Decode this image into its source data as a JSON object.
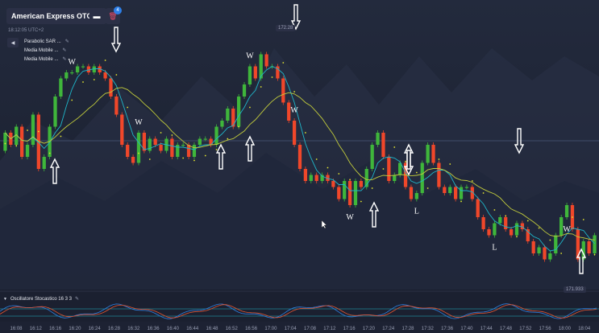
{
  "header": {
    "asset_label": "American Express OTC",
    "menu_icon": "dash-icon",
    "delete_icon": "trash-icon",
    "badge_count": "4",
    "clock": "18:12:05 UTC+2"
  },
  "indicators": [
    {
      "label": "Parabolic SAR ..."
    },
    {
      "label": "Media Mobile ..."
    },
    {
      "label": "Media Mobile ..."
    }
  ],
  "oscillator": {
    "label": "Oscillatore Stocastico  16 3 3"
  },
  "price_tags": {
    "high": "172.28",
    "low": "171.933"
  },
  "colors": {
    "bull": "#3fb63b",
    "bear": "#f0472a",
    "ma_fast": "#1fb6c9",
    "ma_slow": "#c2cc3c",
    "sar": "#e3e52f",
    "stoch_k": "#2e7fe0",
    "stoch_d": "#e5542f",
    "osc_band": "#1fb6c9"
  },
  "chart_data": {
    "type": "candlestick",
    "x_ticks": [
      "16:08",
      "16:12",
      "16:16",
      "16:20",
      "16:24",
      "16:28",
      "16:32",
      "16:36",
      "16:40",
      "16:44",
      "16:48",
      "16:52",
      "16:56",
      "17:00",
      "17:04",
      "17:08",
      "17:12",
      "17:16",
      "17:20",
      "17:24",
      "17:28",
      "17:32",
      "17:36",
      "17:40",
      "17:44",
      "17:48",
      "17:52",
      "17:56",
      "18:00",
      "18:04"
    ],
    "ylim": [
      171.9,
      172.3
    ],
    "candles": [
      {
        "o": 172.11,
        "c": 172.14
      },
      {
        "o": 172.14,
        "c": 172.12
      },
      {
        "o": 172.12,
        "c": 172.15
      },
      {
        "o": 172.15,
        "c": 172.1
      },
      {
        "o": 172.1,
        "c": 172.12
      },
      {
        "o": 172.12,
        "c": 172.17
      },
      {
        "o": 172.17,
        "c": 172.08
      },
      {
        "o": 172.08,
        "c": 172.1
      },
      {
        "o": 172.1,
        "c": 172.15
      },
      {
        "o": 172.15,
        "c": 172.2
      },
      {
        "o": 172.2,
        "c": 172.23
      },
      {
        "o": 172.23,
        "c": 172.24
      },
      {
        "o": 172.24,
        "c": 172.24
      },
      {
        "o": 172.24,
        "c": 172.25
      },
      {
        "o": 172.25,
        "c": 172.25
      },
      {
        "o": 172.25,
        "c": 172.24
      },
      {
        "o": 172.24,
        "c": 172.25
      },
      {
        "o": 172.25,
        "c": 172.24
      },
      {
        "o": 172.24,
        "c": 172.23
      },
      {
        "o": 172.23,
        "c": 172.2
      },
      {
        "o": 172.2,
        "c": 172.17
      },
      {
        "o": 172.17,
        "c": 172.12
      },
      {
        "o": 172.12,
        "c": 172.1
      },
      {
        "o": 172.1,
        "c": 172.09
      },
      {
        "o": 172.09,
        "c": 172.14
      },
      {
        "o": 172.14,
        "c": 172.11
      },
      {
        "o": 172.11,
        "c": 172.13
      },
      {
        "o": 172.13,
        "c": 172.12
      },
      {
        "o": 172.12,
        "c": 172.11
      },
      {
        "o": 172.11,
        "c": 172.13
      },
      {
        "o": 172.13,
        "c": 172.1
      },
      {
        "o": 172.1,
        "c": 172.12
      },
      {
        "o": 172.12,
        "c": 172.12
      },
      {
        "o": 172.12,
        "c": 172.1
      },
      {
        "o": 172.1,
        "c": 172.12
      },
      {
        "o": 172.12,
        "c": 172.13
      },
      {
        "o": 172.13,
        "c": 172.13
      },
      {
        "o": 172.13,
        "c": 172.12
      },
      {
        "o": 172.12,
        "c": 172.15
      },
      {
        "o": 172.15,
        "c": 172.16
      },
      {
        "o": 172.16,
        "c": 172.18
      },
      {
        "o": 172.18,
        "c": 172.15
      },
      {
        "o": 172.15,
        "c": 172.2
      },
      {
        "o": 172.2,
        "c": 172.22
      },
      {
        "o": 172.22,
        "c": 172.25
      },
      {
        "o": 172.25,
        "c": 172.23
      },
      {
        "o": 172.23,
        "c": 172.27
      },
      {
        "o": 172.27,
        "c": 172.25
      },
      {
        "o": 172.25,
        "c": 172.25
      },
      {
        "o": 172.25,
        "c": 172.23
      },
      {
        "o": 172.23,
        "c": 172.19
      },
      {
        "o": 172.19,
        "c": 172.16
      },
      {
        "o": 172.16,
        "c": 172.12
      },
      {
        "o": 172.12,
        "c": 172.08
      },
      {
        "o": 172.08,
        "c": 172.06
      },
      {
        "o": 172.06,
        "c": 172.07
      },
      {
        "o": 172.07,
        "c": 172.06
      },
      {
        "o": 172.06,
        "c": 172.07
      },
      {
        "o": 172.07,
        "c": 172.06
      },
      {
        "o": 172.06,
        "c": 172.05
      },
      {
        "o": 172.05,
        "c": 172.03
      },
      {
        "o": 172.03,
        "c": 172.06
      },
      {
        "o": 172.06,
        "c": 172.02
      },
      {
        "o": 172.02,
        "c": 172.06
      },
      {
        "o": 172.06,
        "c": 172.05
      },
      {
        "o": 172.05,
        "c": 172.08
      },
      {
        "o": 172.08,
        "c": 172.12
      },
      {
        "o": 172.12,
        "c": 172.14
      },
      {
        "o": 172.14,
        "c": 172.1
      },
      {
        "o": 172.1,
        "c": 172.06
      },
      {
        "o": 172.06,
        "c": 172.07
      },
      {
        "o": 172.07,
        "c": 172.09
      },
      {
        "o": 172.09,
        "c": 172.05
      },
      {
        "o": 172.05,
        "c": 172.03
      },
      {
        "o": 172.03,
        "c": 172.04
      },
      {
        "o": 172.04,
        "c": 172.09
      },
      {
        "o": 172.09,
        "c": 172.12
      },
      {
        "o": 172.12,
        "c": 172.09
      },
      {
        "o": 172.09,
        "c": 172.05
      },
      {
        "o": 172.05,
        "c": 172.04
      },
      {
        "o": 172.04,
        "c": 172.05
      },
      {
        "o": 172.05,
        "c": 172.03
      },
      {
        "o": 172.03,
        "c": 172.05
      },
      {
        "o": 172.05,
        "c": 172.05
      },
      {
        "o": 172.05,
        "c": 172.03
      },
      {
        "o": 172.03,
        "c": 172.0
      },
      {
        "o": 172.0,
        "c": 171.98
      },
      {
        "o": 171.98,
        "c": 171.97
      },
      {
        "o": 171.97,
        "c": 171.99
      },
      {
        "o": 171.99,
        "c": 172.0
      },
      {
        "o": 172.0,
        "c": 171.98
      },
      {
        "o": 171.98,
        "c": 171.97
      },
      {
        "o": 171.97,
        "c": 171.99
      },
      {
        "o": 171.99,
        "c": 171.98
      },
      {
        "o": 171.98,
        "c": 171.96
      },
      {
        "o": 171.96,
        "c": 171.94
      },
      {
        "o": 171.94,
        "c": 171.95
      },
      {
        "o": 171.95,
        "c": 171.93
      },
      {
        "o": 171.93,
        "c": 171.94
      },
      {
        "o": 171.94,
        "c": 171.97
      },
      {
        "o": 171.97,
        "c": 172.0
      },
      {
        "o": 172.0,
        "c": 172.02
      },
      {
        "o": 172.02,
        "c": 171.98
      },
      {
        "o": 171.98,
        "c": 171.93
      },
      {
        "o": 171.93,
        "c": 171.96
      },
      {
        "o": 171.96,
        "c": 171.94
      },
      {
        "o": 171.94,
        "c": 171.97
      }
    ]
  },
  "annotations": [
    {
      "text": "W"
    },
    {
      "text": "W"
    },
    {
      "text": "W"
    },
    {
      "text": "W"
    },
    {
      "text": "W"
    },
    {
      "text": "W"
    },
    {
      "text": "W"
    },
    {
      "text": "L"
    },
    {
      "text": "L"
    }
  ]
}
